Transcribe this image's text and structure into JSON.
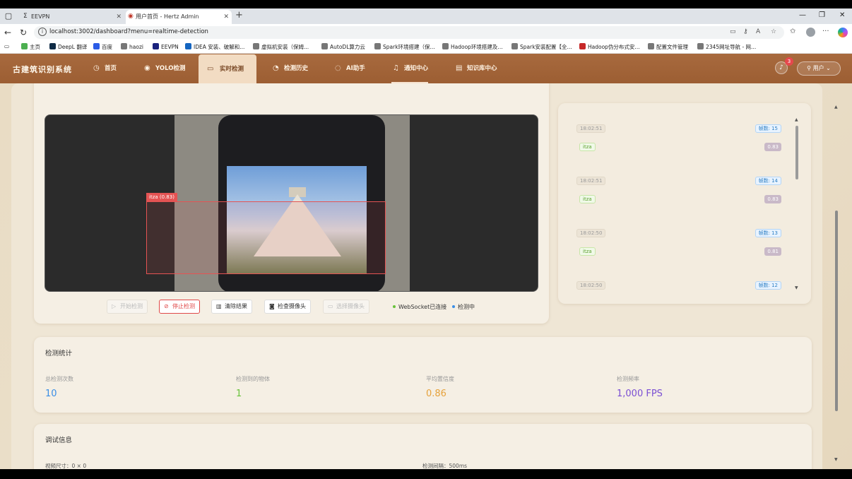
{
  "browser": {
    "tabs": [
      {
        "label": "EEVPN",
        "favicon": "Σ"
      },
      {
        "label": "用户首页 - Hertz Admin",
        "favicon": "◉"
      }
    ],
    "url": "localhost:3002/dashboard?menu=realtime-detection",
    "bookmarks": [
      "主页",
      "DeepL 翻译",
      "百度",
      "haozi",
      "EEVPN",
      "IDEA 安装、破解和...",
      "虚拟机安装（保姆...",
      "AutoDL算力云",
      "Spark环境搭建（保...",
      "Hadoop环境搭建及...",
      "Spark安装配置【全...",
      "Hadoop伪分布式安...",
      "配置文件管理",
      "2345网址导航 - 网..."
    ]
  },
  "app": {
    "brand": "古建筑识别系统",
    "menu": [
      {
        "label": "首页",
        "icon": "dashboard-icon"
      },
      {
        "label": "YOLO检测",
        "icon": "eye-icon"
      },
      {
        "label": "实时检测",
        "icon": "video-icon"
      },
      {
        "label": "检测历史",
        "icon": "history-icon"
      },
      {
        "label": "AI助手",
        "icon": "chat-icon"
      },
      {
        "label": "通知中心",
        "icon": "bell-icon"
      },
      {
        "label": "知识库中心",
        "icon": "book-icon"
      }
    ],
    "notification_count": "3",
    "user_label": "用户"
  },
  "video": {
    "detection_label": "itza (0.83)"
  },
  "controls": {
    "start": "开始检测",
    "stop": "停止检测",
    "clear": "清除结果",
    "check_camera": "检查摄像头",
    "select_camera": "选择摄像头",
    "ws_status": "WebSocket已连接",
    "detect_status": "检测中"
  },
  "history": [
    {
      "time": "18:02:51",
      "frame": "帧数: 15",
      "cls": "itza",
      "conf": "0.83"
    },
    {
      "time": "18:02:51",
      "frame": "帧数: 14",
      "cls": "itza",
      "conf": "0.83"
    },
    {
      "time": "18:02:50",
      "frame": "帧数: 13",
      "cls": "itza",
      "conf": "0.81"
    },
    {
      "time": "18:02:50",
      "frame": "帧数: 12",
      "cls": "",
      "conf": ""
    }
  ],
  "stats": {
    "title": "检测统计",
    "items": [
      {
        "label": "总检测次数",
        "value": "10",
        "color": "#3a8ee6"
      },
      {
        "label": "检测到的物体",
        "value": "1",
        "color": "#67c23a"
      },
      {
        "label": "平均置信度",
        "value": "0.86",
        "color": "#e6a23c"
      },
      {
        "label": "检测频率",
        "value": "1,000 FPS",
        "color": "#7b4fd3"
      }
    ]
  },
  "debug": {
    "title": "调试信息",
    "frame_size": "视频尺寸：0 × 0",
    "interval": "检测间隔：500ms"
  }
}
